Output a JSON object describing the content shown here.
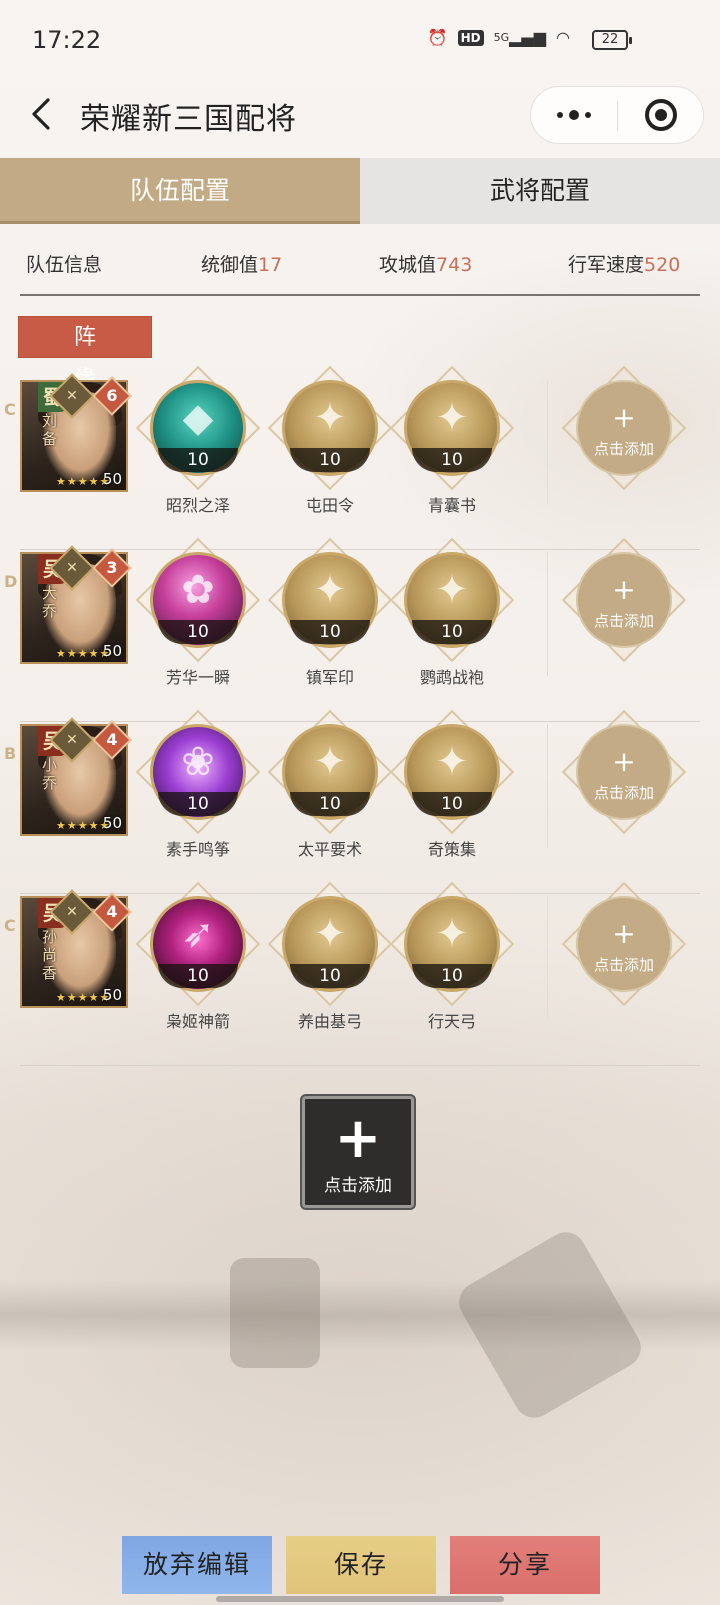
{
  "status_bar": {
    "time": "17:22",
    "icons": [
      "alarm-icon",
      "hd-icon",
      "signal-5g-icon",
      "wifi-icon"
    ],
    "hd": "HD",
    "network": "5G",
    "battery": "22"
  },
  "nav": {
    "title": "荣耀新三国配将",
    "back_icon": "chevron-left-icon",
    "more_icon": "more-icon",
    "close_icon": "target-icon"
  },
  "tabs": [
    {
      "label": "队伍配置",
      "active": true
    },
    {
      "label": "武将配置",
      "active": false
    }
  ],
  "team_info": {
    "label": "队伍信息",
    "command_label": "统御值",
    "command_value": "17",
    "siege_label": "攻城值",
    "siege_value": "743",
    "speed_label": "行军速度",
    "speed_value": "520"
  },
  "formation_label": "阵缘",
  "add_label": "点击添加",
  "rows": [
    {
      "hero": {
        "kingdom": "蜀",
        "name": "刘备",
        "letter": "C",
        "stars_count": 5,
        "rank": "6",
        "level": "50"
      },
      "items": [
        {
          "name": "昭烈之泽",
          "level": "10",
          "style": "teal"
        },
        {
          "name": "屯田令",
          "level": "10",
          "style": "gold"
        },
        {
          "name": "青囊书",
          "level": "10",
          "style": "gold"
        }
      ]
    },
    {
      "hero": {
        "kingdom": "吴",
        "name": "大乔",
        "letter": "D",
        "stars_count": 5,
        "rank": "3",
        "level": "50"
      },
      "items": [
        {
          "name": "芳华一瞬",
          "level": "10",
          "style": "pink"
        },
        {
          "name": "镇军印",
          "level": "10",
          "style": "gold"
        },
        {
          "name": "鹦鹉战袍",
          "level": "10",
          "style": "gold"
        }
      ]
    },
    {
      "hero": {
        "kingdom": "吴",
        "name": "小乔",
        "letter": "B",
        "stars_count": 5,
        "rank": "4",
        "level": "50"
      },
      "items": [
        {
          "name": "素手鸣筝",
          "level": "10",
          "style": "purple"
        },
        {
          "name": "太平要术",
          "level": "10",
          "style": "gold"
        },
        {
          "name": "奇策集",
          "level": "10",
          "style": "gold"
        }
      ]
    },
    {
      "hero": {
        "kingdom": "吴",
        "name": "孙尚香",
        "letter": "C",
        "stars_count": 5,
        "rank": "4",
        "level": "50"
      },
      "items": [
        {
          "name": "枭姬神箭",
          "level": "10",
          "style": "magenta"
        },
        {
          "name": "养由基弓",
          "level": "10",
          "style": "gold"
        },
        {
          "name": "行天弓",
          "level": "10",
          "style": "gold"
        }
      ]
    }
  ],
  "big_add": {
    "label": "点击添加"
  },
  "bottom": {
    "discard": "放弃编辑",
    "save": "保存",
    "share": "分享"
  }
}
